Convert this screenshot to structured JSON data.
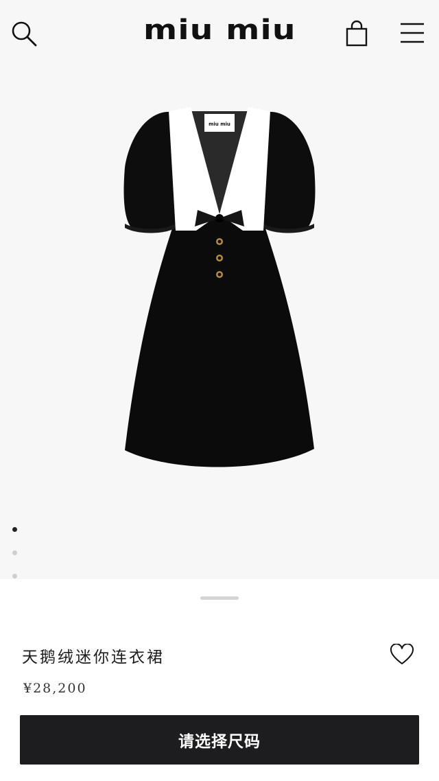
{
  "header": {
    "brand": "miu miu",
    "icons": [
      "search-icon",
      "shopping-bag-icon",
      "hamburger-menu-icon"
    ]
  },
  "product": {
    "title": "天鹅绒迷你连衣裙",
    "price": "¥28,200",
    "label_brand": "miu miu",
    "image_pager": {
      "total": 5,
      "current": 1
    }
  },
  "actions": {
    "select_size_label": "请选择尺码",
    "favorite_icon": "heart-outline-icon"
  },
  "colors": {
    "background": "#f7f7f7",
    "sheet": "#ffffff",
    "button": "#1d1d1f",
    "button_text": "#ffffff",
    "dot_active": "#222222",
    "dot_inactive": "#cfcfcf"
  }
}
